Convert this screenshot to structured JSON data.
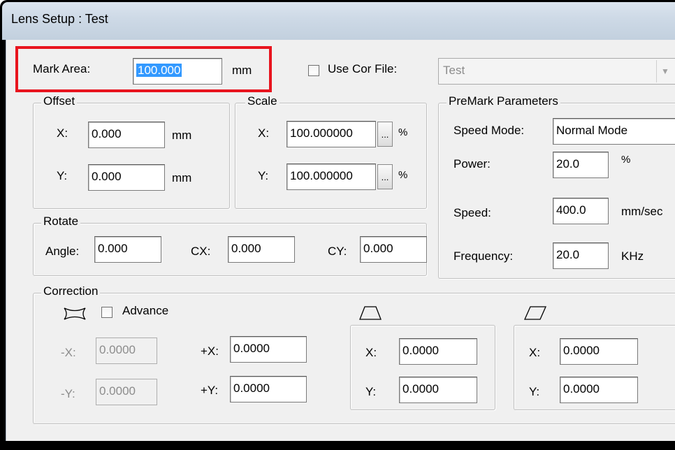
{
  "window": {
    "title": "Lens Setup : Test"
  },
  "mark_area": {
    "label": "Mark Area:",
    "value": "100.000",
    "unit": "mm"
  },
  "cor_file": {
    "checkbox_label": "Use Cor File:",
    "checked": false,
    "selected": "Test"
  },
  "offset": {
    "legend": "Offset",
    "x_label": "X:",
    "x_value": "0.000",
    "x_unit": "mm",
    "y_label": "Y:",
    "y_value": "0.000",
    "y_unit": "mm"
  },
  "scale": {
    "legend": "Scale",
    "x_label": "X:",
    "x_value": "100.000000",
    "x_unit": "%",
    "y_label": "Y:",
    "y_value": "100.000000",
    "y_unit": "%",
    "browse_label": "..."
  },
  "premark": {
    "legend": "PreMark Parameters",
    "speed_mode_label": "Speed Mode:",
    "speed_mode_value": "Normal Mode",
    "power_label": "Power:",
    "power_value": "20.0",
    "power_unit": "%",
    "speed_label": "Speed:",
    "speed_value": "400.0",
    "speed_unit": "mm/sec",
    "frequency_label": "Frequency:",
    "frequency_value": "20.0",
    "frequency_unit": "KHz"
  },
  "rotate": {
    "legend": "Rotate",
    "angle_label": "Angle:",
    "angle_value": "0.000",
    "cx_label": "CX:",
    "cx_value": "0.000",
    "cy_label": "CY:",
    "cy_value": "0.000"
  },
  "correction": {
    "legend": "Correction",
    "advance_label": "Advance",
    "advance_checked": false,
    "neg_x_label": "-X:",
    "neg_x_value": "0.0000",
    "neg_y_label": "-Y:",
    "neg_y_value": "0.0000",
    "pos_x_label": "+X:",
    "pos_x_value": "0.0000",
    "pos_y_label": "+Y:",
    "pos_y_value": "0.0000",
    "trapezoid": {
      "x_label": "X:",
      "x_value": "0.0000",
      "y_label": "Y:",
      "y_value": "0.0000"
    },
    "parallelogram": {
      "x_label": "X:",
      "x_value": "0.0000",
      "y_label": "Y:",
      "y_value": "0.0000"
    }
  },
  "colors": {
    "highlight": "#e8141e",
    "selection": "#3399ff"
  }
}
